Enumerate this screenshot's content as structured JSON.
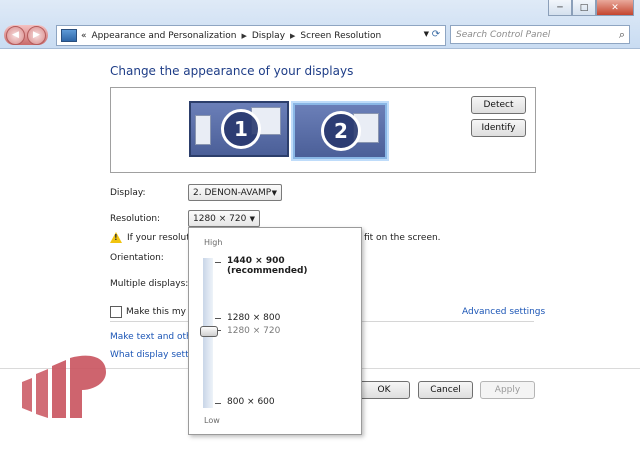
{
  "window": {
    "minimize": "─",
    "maximize": "□",
    "close": "✕"
  },
  "address": {
    "prefix": "«",
    "crumbs": [
      "Appearance and Personalization",
      "Display",
      "Screen Resolution"
    ]
  },
  "search": {
    "placeholder": "Search Control Panel"
  },
  "heading": "Change the appearance of your displays",
  "monitors": {
    "one": "1",
    "two": "2",
    "detect": "Detect",
    "identify": "Identify"
  },
  "display_row": {
    "label": "Display:",
    "value": "2. DENON-AVAMP"
  },
  "resolution_row": {
    "label": "Resolution:",
    "value": "1280 × 720"
  },
  "warning": {
    "text_start": "If your resolutio",
    "text_end": "fit on the screen."
  },
  "orientation": {
    "label": "Orientation:"
  },
  "multiple": {
    "label": "Multiple displays:"
  },
  "make_main": {
    "label": "Make this my ma"
  },
  "advanced": "Advanced settings",
  "links": {
    "text_size": "Make text and other",
    "what_settings": "What display setting"
  },
  "footer": {
    "ok": "OK",
    "cancel": "Cancel",
    "apply": "Apply"
  },
  "resolution_popup": {
    "high": "High",
    "low": "Low",
    "options": [
      "1440 × 900 (recommended)",
      "1280 × 800",
      "1280 × 720",
      "800 × 600"
    ],
    "selected": "1280 × 720"
  }
}
